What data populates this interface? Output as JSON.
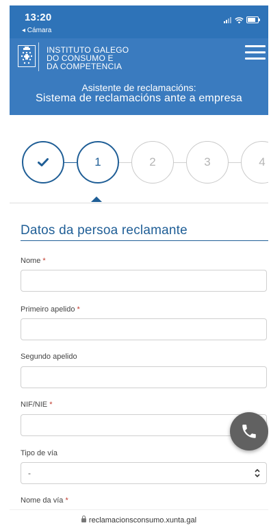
{
  "status_bar": {
    "time": "13:20",
    "back_app": "◂ Cámara"
  },
  "header": {
    "institute_lines": [
      "INSTITUTO GALEGO",
      "DO CONSUMO E",
      "DA COMPETENCIA"
    ],
    "subtitle_line1": "Asistente de reclamacións:",
    "subtitle_line2": "Sistema de reclamacións ante a empresa"
  },
  "stepper": {
    "steps": [
      "1",
      "2",
      "3",
      "4"
    ]
  },
  "form": {
    "section_title": "Datos da persoa reclamante",
    "required_mark": "*",
    "fields": {
      "nome": {
        "label": "Nome",
        "value": ""
      },
      "primeiro_apelido": {
        "label": "Primeiro apelido",
        "value": ""
      },
      "segundo_apelido": {
        "label": "Segundo apelido",
        "value": ""
      },
      "nif_nie": {
        "label": "NIF/NIE",
        "value": ""
      },
      "tipo_via": {
        "label": "Tipo de vía",
        "selected": "-"
      },
      "nome_via": {
        "label": "Nome da vía"
      }
    }
  },
  "icons": {
    "call": "phone-icon",
    "menu": "hamburger-menu-icon",
    "check": "check-icon",
    "lock": "lock-icon"
  },
  "colors": {
    "header_blue": "#3a7bbf",
    "accent_blue": "#1f5e96",
    "required_red": "#c0392b",
    "call_button": "#616161"
  },
  "url_bar": {
    "domain": "reclamacionsconsumo.xunta.gal"
  }
}
